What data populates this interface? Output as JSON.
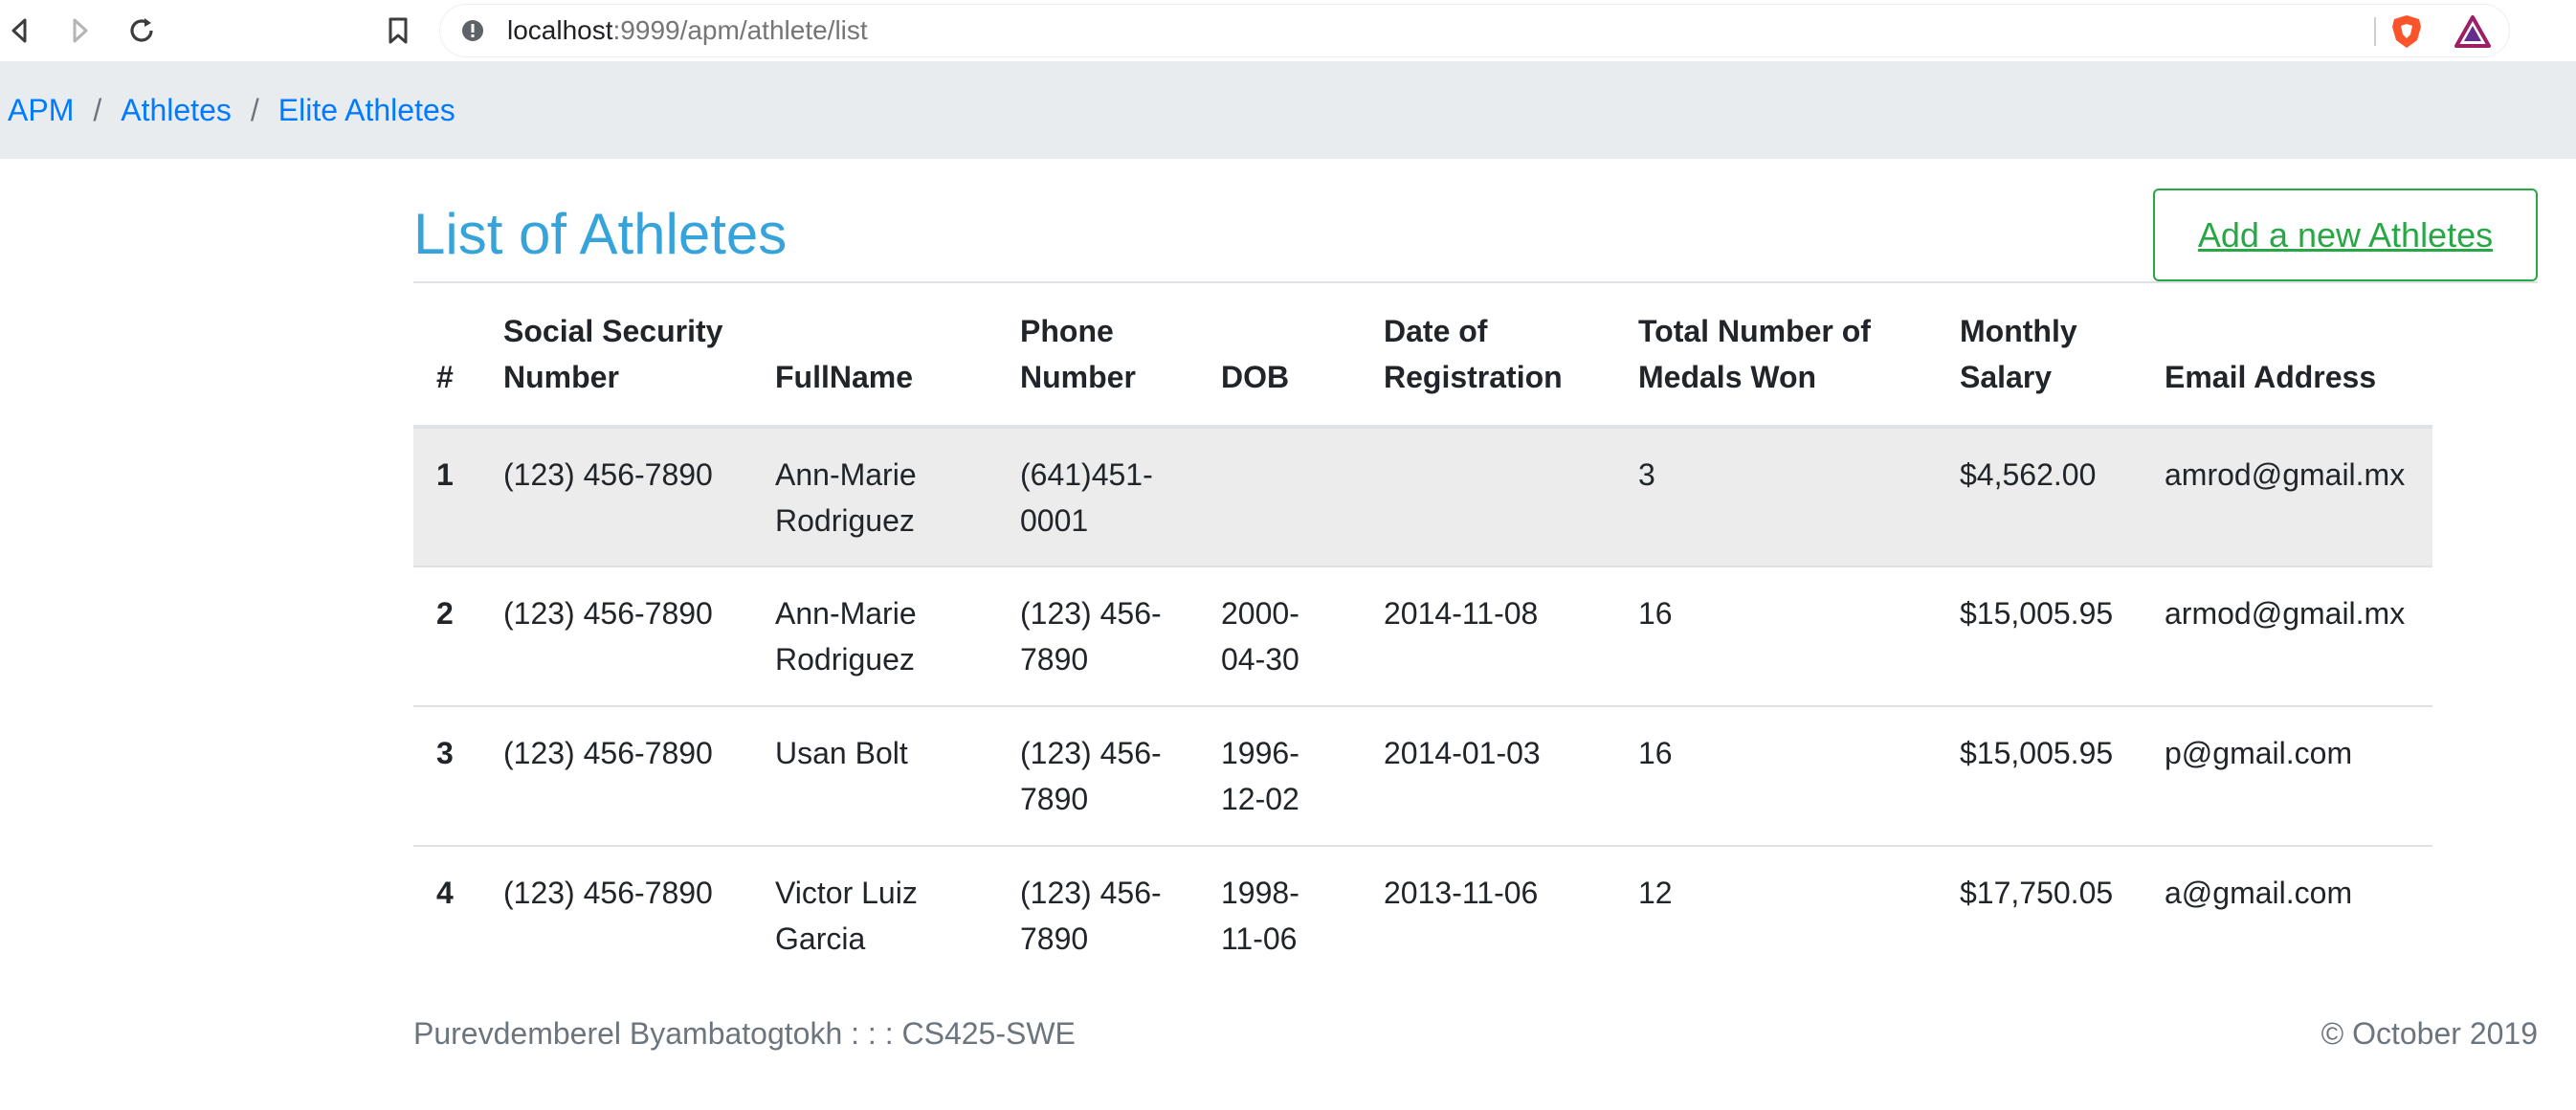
{
  "browser": {
    "url_host": "localhost",
    "url_rest": ":9999/apm/athlete/list",
    "icons": [
      "back-icon",
      "forward-icon",
      "reload-icon",
      "bookmark-icon",
      "info-icon",
      "brave-shield-icon",
      "bat-rewards-icon"
    ]
  },
  "breadcrumb": {
    "items": [
      "APM",
      "Athletes",
      "Elite Athletes"
    ],
    "separator": "/"
  },
  "page": {
    "title": "List of Athletes",
    "add_button": "Add a new Athletes"
  },
  "table": {
    "headers": {
      "num": "#",
      "ssn_1": "Social Security",
      "ssn_2": "Number",
      "fullname": "FullName",
      "phone_1": "Phone",
      "phone_2": "Number",
      "dob": "DOB",
      "reg_1": "Date of",
      "reg_2": "Registration",
      "medals_1": "Total Number of",
      "medals_2": "Medals Won",
      "salary_1": "Monthly",
      "salary_2": "Salary",
      "email": "Email Address"
    },
    "rows": [
      {
        "num": "1",
        "ssn": "(123) 456-7890",
        "name_1": "Ann-Marie",
        "name_2": "Rodriguez",
        "phone_1": "(641)451-",
        "phone_2": "0001",
        "dob_1": "",
        "dob_2": "",
        "registration": "",
        "medals": "3",
        "salary": "$4,562.00",
        "email": "amrod@gmail.mx"
      },
      {
        "num": "2",
        "ssn": "(123) 456-7890",
        "name_1": "Ann-Marie",
        "name_2": "Rodriguez",
        "phone_1": "(123) 456-",
        "phone_2": "7890",
        "dob_1": "2000-",
        "dob_2": "04-30",
        "registration": "2014-11-08",
        "medals": "16",
        "salary": "$15,005.95",
        "email": "armod@gmail.mx"
      },
      {
        "num": "3",
        "ssn": "(123) 456-7890",
        "name_1": "Usan Bolt",
        "name_2": "",
        "phone_1": "(123) 456-",
        "phone_2": "7890",
        "dob_1": "1996-",
        "dob_2": "12-02",
        "registration": "2014-01-03",
        "medals": "16",
        "salary": "$15,005.95",
        "email": "p@gmail.com"
      },
      {
        "num": "4",
        "ssn": "(123) 456-7890",
        "name_1": "Victor Luiz",
        "name_2": "Garcia",
        "phone_1": "(123) 456-",
        "phone_2": "7890",
        "dob_1": "1998-",
        "dob_2": "11-06",
        "registration": "2013-11-06",
        "medals": "12",
        "salary": "$17,750.05",
        "email": "a@gmail.com"
      }
    ]
  },
  "footer": {
    "left": "Purevdemberel Byambatogtokh : : : CS425-SWE",
    "right": "© October 2019"
  },
  "colors": {
    "link": "#007bff",
    "title": "#36a3db",
    "add_button": "#28a745",
    "breadcrumb_bg": "#e9ecef",
    "row_shade": "#ececec"
  }
}
